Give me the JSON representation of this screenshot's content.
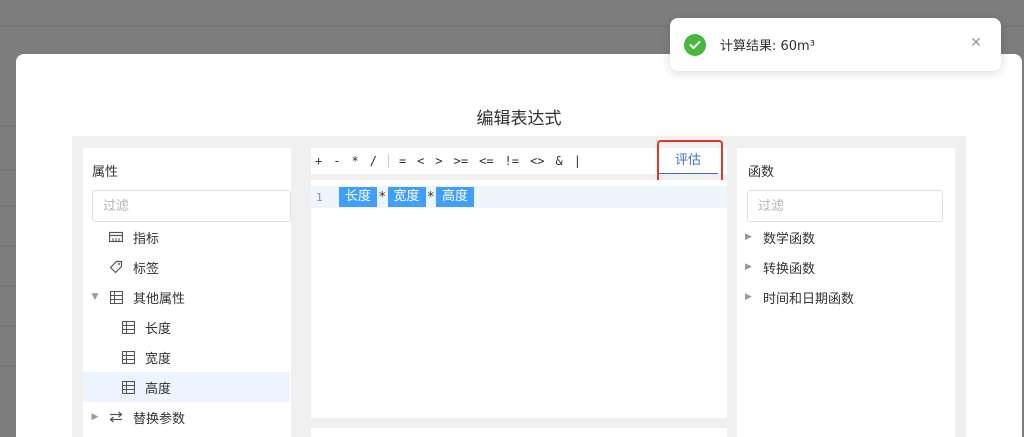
{
  "dialog": {
    "title": "编辑表达式"
  },
  "attributes_panel": {
    "title": "属性",
    "filter_placeholder": "过滤",
    "items": [
      {
        "label": "指标",
        "icon": "indicator-icon"
      },
      {
        "label": "标签",
        "icon": "tag-icon"
      },
      {
        "label": "其他属性",
        "icon": "table-icon",
        "expanded": true
      },
      {
        "label": "长度",
        "icon": "table-icon"
      },
      {
        "label": "宽度",
        "icon": "table-icon"
      },
      {
        "label": "高度",
        "icon": "table-icon",
        "selected": true
      },
      {
        "label": "替换参数",
        "icon": "swap-icon",
        "expanded": false
      }
    ]
  },
  "toolbar": {
    "operators": [
      "+",
      "-",
      "*",
      "/",
      "=",
      "<",
      ">",
      ">=",
      "<=",
      "!=",
      "<>",
      "&",
      "|"
    ],
    "evaluate_label": "评估"
  },
  "editor": {
    "line_number": "1",
    "tokens": [
      "长度",
      "宽度",
      "高度"
    ],
    "operator": "*"
  },
  "functions_panel": {
    "title": "函数",
    "filter_placeholder": "过滤",
    "items": [
      "数学函数",
      "转换函数",
      "时间和日期函数"
    ]
  },
  "toast": {
    "message": "计算结果: 60m³",
    "status_color": "#46b83a",
    "close_glyph": "✕"
  },
  "colors": {
    "accent": "#409eff",
    "highlight_border": "#e0352c",
    "link": "#3a6fd8"
  }
}
